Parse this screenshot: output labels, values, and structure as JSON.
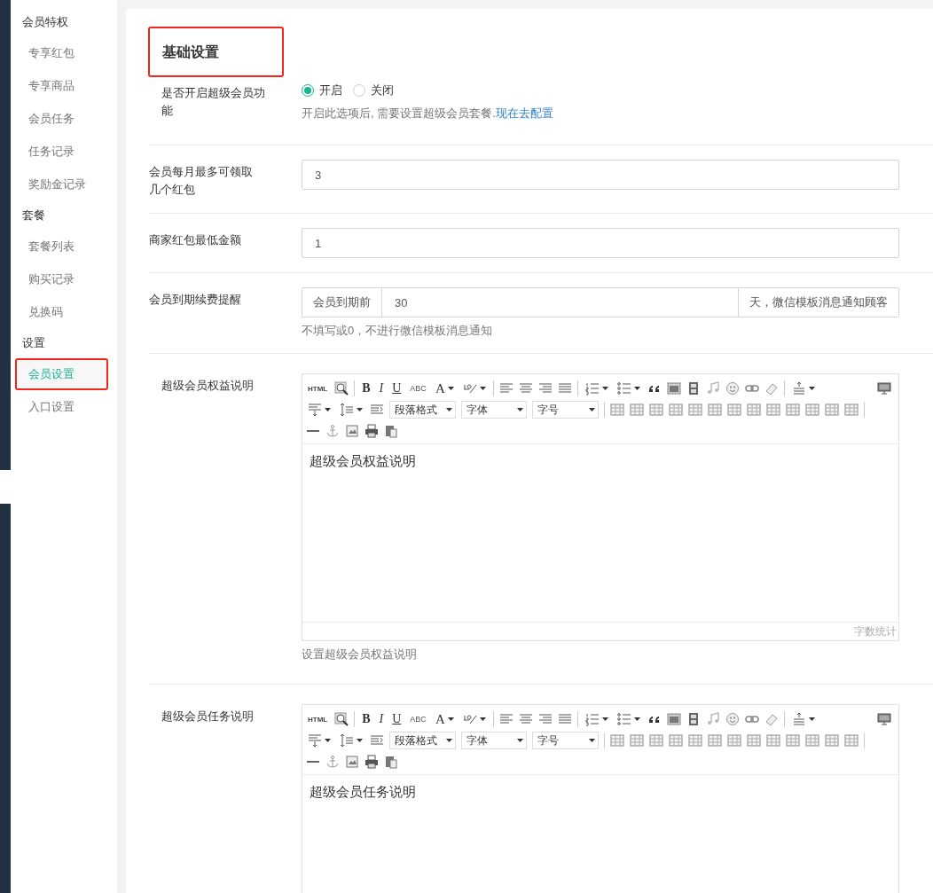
{
  "sidebar": {
    "groups": [
      {
        "title": "会员特权",
        "items": [
          {
            "label": "专享红包",
            "selected": false,
            "highlighted": false
          },
          {
            "label": "专享商品",
            "selected": false,
            "highlighted": false
          },
          {
            "label": "会员任务",
            "selected": false,
            "highlighted": false
          },
          {
            "label": "任务记录",
            "selected": false,
            "highlighted": false
          },
          {
            "label": "奖励金记录",
            "selected": false,
            "highlighted": false
          }
        ]
      },
      {
        "title": "套餐",
        "items": [
          {
            "label": "套餐列表",
            "selected": false,
            "highlighted": false
          },
          {
            "label": "购买记录",
            "selected": false,
            "highlighted": false
          },
          {
            "label": "兑换码",
            "selected": false,
            "highlighted": false
          }
        ]
      },
      {
        "title": "设置",
        "items": [
          {
            "label": "会员设置",
            "selected": true,
            "highlighted": true
          },
          {
            "label": "入口设置",
            "selected": false,
            "highlighted": false
          }
        ]
      }
    ]
  },
  "section": {
    "title": "基础设置",
    "highlighted": true
  },
  "form": {
    "rows": [
      {
        "kind": "radio",
        "label": "是否开启超级会员功能",
        "options": [
          {
            "label": "开启",
            "selected": true
          },
          {
            "label": "关闭",
            "selected": false
          }
        ],
        "help": "开启此选项后, 需要设置超级会员套餐.",
        "help_link": "现在去配置"
      },
      {
        "kind": "input",
        "label": "会员每月最多可领取几个红包",
        "value": "3"
      },
      {
        "kind": "input",
        "label": "商家红包最低金额",
        "value": "1"
      },
      {
        "kind": "input_group",
        "label": "会员到期续费提醒",
        "prefix": "会员到期前",
        "value": "30",
        "suffix": "天，微信模板消息通知顾客",
        "help": "不填写或0，不进行微信模板消息通知"
      },
      {
        "kind": "editor",
        "label": "超级会员权益说明",
        "toolbar": {
          "html": "HTML",
          "bold": "B",
          "italic": "I",
          "underline": "U",
          "strike": "ABC",
          "font_color": "A",
          "paragraph": "段落格式",
          "font_family": "字体",
          "font_size": "字号"
        },
        "content": "超级会员权益说明",
        "word_count": "字数统计",
        "help": "设置超级会员权益说明"
      },
      {
        "kind": "editor",
        "label": "超级会员任务说明",
        "toolbar": {
          "html": "HTML",
          "bold": "B",
          "italic": "I",
          "underline": "U",
          "strike": "ABC",
          "font_color": "A",
          "paragraph": "段落格式",
          "font_family": "字体",
          "font_size": "字号"
        },
        "content": "超级会员任务说明"
      }
    ]
  }
}
